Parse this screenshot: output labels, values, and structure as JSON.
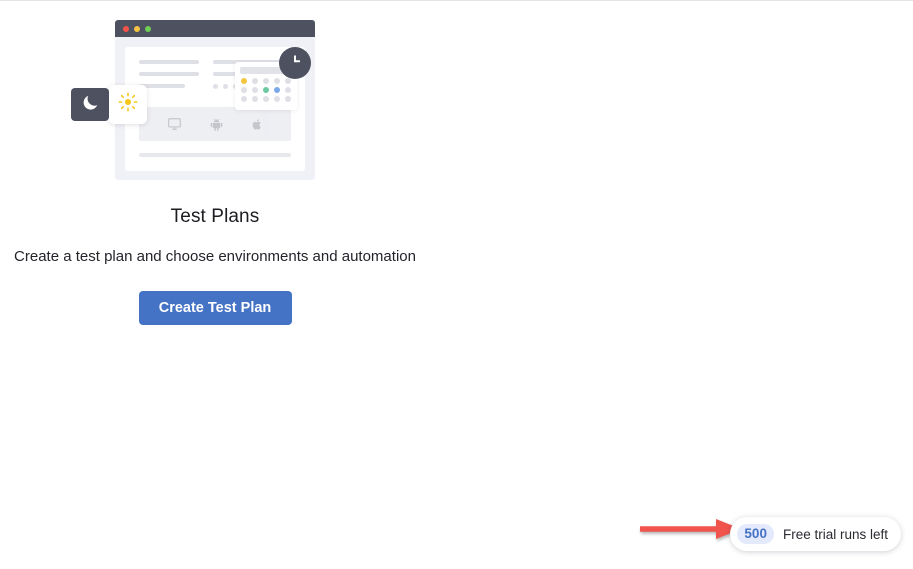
{
  "page": {
    "background_color": "#ffffff"
  },
  "empty_state": {
    "title": "Test Plans",
    "subtitle": "Create a test plan and choose environments and automation",
    "cta_label": "Create Test Plan",
    "cta_color": "#4472c4"
  },
  "illustration": {
    "window_titlebar_color": "#4d5160",
    "traffic_lights": [
      {
        "name": "close",
        "color": "#f4544a"
      },
      {
        "name": "minimize",
        "color": "#f6c343"
      },
      {
        "name": "maximize",
        "color": "#6fcf52"
      }
    ],
    "skeleton": {
      "left_lines": 3,
      "right_lines": 2,
      "right_dots": 8,
      "placeholder_color": "#dfe0e6"
    },
    "devices": [
      {
        "name": "desktop",
        "icon": "monitor-icon"
      },
      {
        "name": "android",
        "icon": "android-icon"
      },
      {
        "name": "apple",
        "icon": "apple-icon"
      }
    ],
    "calendar": {
      "dots": [
        [
          "yellow",
          "grey",
          "grey",
          "grey",
          "grey"
        ],
        [
          "grey",
          "grey",
          "green",
          "blue",
          "grey"
        ],
        [
          "grey",
          "grey",
          "grey",
          "grey",
          "grey"
        ]
      ],
      "colors": {
        "grey": "#dfe0e6",
        "yellow": "#f3c63f",
        "green": "#6cc9a0",
        "blue": "#7aa8e8"
      }
    },
    "clock_badge": {
      "icon": "clock-icon",
      "color": "#4d5160"
    },
    "theme_toggle": {
      "dark": {
        "icon": "moon-icon",
        "background": "#4d5160"
      },
      "light": {
        "icon": "sun-icon",
        "background": "#ffffff",
        "glyph_color": "#f5c518"
      }
    }
  },
  "trial_badge": {
    "count": "500",
    "label": "Free trial runs left",
    "count_color": "#4472c4",
    "count_background": "#e4e9fb"
  },
  "annotation": {
    "arrow": {
      "name": "pointer-arrow",
      "color": "#f0544c",
      "direction": "right"
    }
  }
}
